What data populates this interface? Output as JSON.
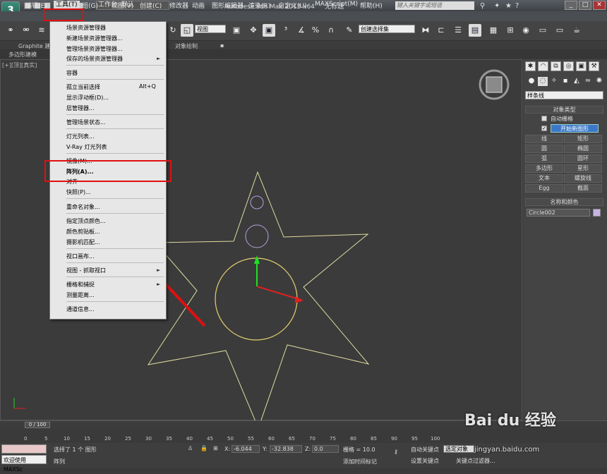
{
  "app": {
    "title": "Autodesk 3ds Max  2013 x64",
    "doc_title": "无标题",
    "workspace": "工作台: 默认",
    "search_placeholder": "键入关键字或短语"
  },
  "menubar": {
    "items": [
      "编辑(E)",
      "工具(T)",
      "组(G)",
      "视图(V)",
      "创建(C)",
      "修改器",
      "动画",
      "图形编辑器",
      "渲染(R)",
      "自定义(U)",
      "MAXScript(M)",
      "帮助(H)"
    ]
  },
  "toolbar": {
    "view_dropdown": "视图",
    "selection_set": "创建选择集"
  },
  "ribbon": {
    "tab_graphite": "Graphite 建",
    "tab_object_paint": "对象绘制",
    "subtab": "多边形建模"
  },
  "viewport": {
    "label": "[+][顶][真实]"
  },
  "tools_menu": {
    "items": [
      {
        "label": "场景资源管理器",
        "shortcut": "",
        "arrow": false
      },
      {
        "label": "新建场景资源管理器...",
        "shortcut": "",
        "arrow": false
      },
      {
        "label": "管理场景资源管理器...",
        "shortcut": "",
        "arrow": false
      },
      {
        "label": "保存的场景资源管理器",
        "shortcut": "",
        "arrow": true
      },
      {
        "label": "容器",
        "shortcut": "",
        "arrow": false
      },
      {
        "label": "孤立当前选择",
        "shortcut": "Alt+Q",
        "arrow": false
      },
      {
        "label": "显示浮动框(D)...",
        "shortcut": "",
        "arrow": false
      },
      {
        "label": "层管理器...",
        "shortcut": "",
        "arrow": false
      },
      {
        "label": "管理场景状态...",
        "shortcut": "",
        "arrow": false
      },
      {
        "label": "灯光列表...",
        "shortcut": "",
        "arrow": false
      },
      {
        "label": "V-Ray 灯光列表",
        "shortcut": "",
        "arrow": false
      },
      {
        "label": "镜像(M)...",
        "shortcut": "",
        "arrow": false
      },
      {
        "label": "阵列(A)...",
        "shortcut": "",
        "arrow": false
      },
      {
        "label": "对齐",
        "shortcut": "",
        "arrow": false
      },
      {
        "label": "快照(P)...",
        "shortcut": "",
        "arrow": false
      },
      {
        "label": "重命名对象...",
        "shortcut": "",
        "arrow": false
      },
      {
        "label": "指定顶点颜色...",
        "shortcut": "",
        "arrow": false
      },
      {
        "label": "颜色剪贴板...",
        "shortcut": "",
        "arrow": false
      },
      {
        "label": "摄影机匹配...",
        "shortcut": "",
        "arrow": false
      },
      {
        "label": "视口画布...",
        "shortcut": "",
        "arrow": false
      },
      {
        "label": "视图 - 抓取视口",
        "shortcut": "",
        "arrow": true
      },
      {
        "label": "栅格和捕捉",
        "shortcut": "",
        "arrow": true
      },
      {
        "label": "测量距离...",
        "shortcut": "",
        "arrow": false
      },
      {
        "label": "通道信息...",
        "shortcut": "",
        "arrow": false
      }
    ]
  },
  "command_panel": {
    "category": "样条线",
    "object_type_header": "对象类型",
    "auto_grid": "自动栅格",
    "start_new_shape": "开始新图形",
    "buttons": [
      "线",
      "矩形",
      "圆",
      "椭圆",
      "弧",
      "圆环",
      "多边形",
      "星形",
      "文本",
      "螺旋线",
      "Egg",
      "截面"
    ],
    "name_color_header": "名称和颜色",
    "object_name": "Circle002",
    "object_color": "#c6b4e6"
  },
  "timeline": {
    "frame": "0 / 100",
    "ticks": [
      "0",
      "5",
      "10",
      "15",
      "20",
      "25",
      "30",
      "35",
      "40",
      "45",
      "50",
      "55",
      "60",
      "65",
      "70",
      "75",
      "80",
      "85",
      "90",
      "95",
      "100"
    ]
  },
  "status": {
    "welcome": "欢迎使用 MAXSc",
    "selected": "选择了 1 个 图形",
    "prompt": "阵列",
    "x_label": "X:",
    "x_value": "-6.044",
    "y_label": "Y:",
    "y_value": "-32.838",
    "z_label": "Z:",
    "z_value": "0.0",
    "grid": "栅格 = 10.0",
    "auto_key": "自动关键点",
    "selected_obj": "选定对象",
    "set_key": "设置关键点",
    "key_filters": "关键点过滤器...",
    "add_time_tag": "添加时间标记"
  },
  "colors": {
    "highlight_red": "#e01010",
    "star_outline": "#dedca0",
    "circle_outline": "#e6d070",
    "small_circle": "#b8a0e0"
  },
  "watermark": {
    "brand": "Bai du 经验",
    "url": "jingyan.baidu.com"
  }
}
